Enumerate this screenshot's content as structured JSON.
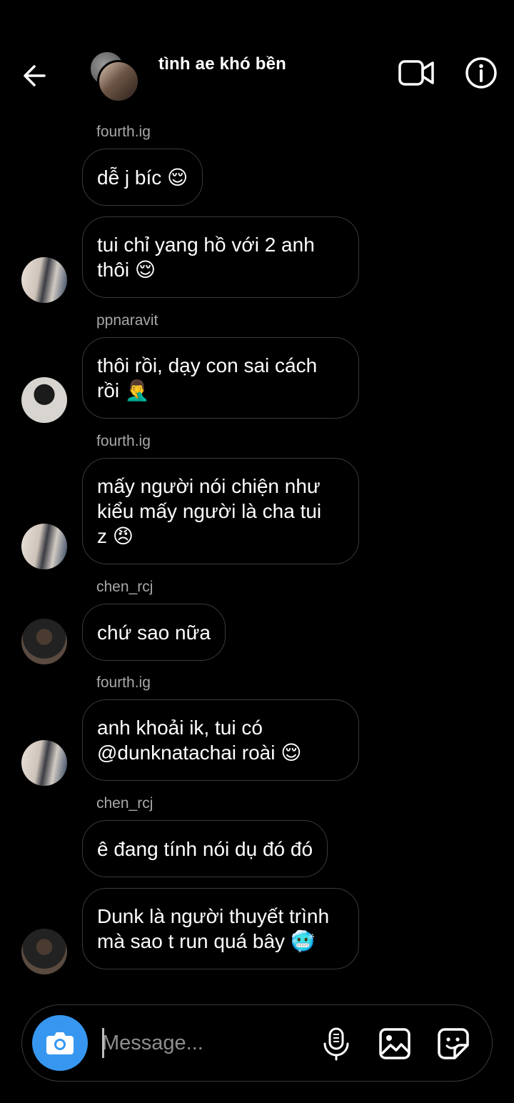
{
  "header": {
    "title": "tình ae khó bền"
  },
  "messages": [
    {
      "sender": "fourth.ig",
      "text": "dễ j bíc 😌"
    },
    {
      "sender": "fourth.ig",
      "text": "tui chỉ yang hồ với 2 anh\nthôi 😌"
    },
    {
      "sender": "ppnaravit",
      "text": "thôi rồi, dạy con sai cách\nrồi 🤦‍♂️"
    },
    {
      "sender": "fourth.ig",
      "text": "mấy người nói chiện như\nkiểu mấy người là cha tui\nz 😠"
    },
    {
      "sender": "chen_rcj",
      "text": "chứ sao nữa"
    },
    {
      "sender": "fourth.ig",
      "text": "anh khoải ik, tui có\n@dunknatachai roài 😌"
    },
    {
      "sender": "chen_rcj",
      "text": "ê đang tính nói dụ đó đó"
    },
    {
      "sender": "chen_rcj",
      "text": "Dunk là người thuyết trình\nmà sao t run quá bây 🥶"
    }
  ],
  "composer": {
    "placeholder": "Message..."
  },
  "icons": {
    "back": "arrow-left-icon",
    "video": "video-camera-icon",
    "info": "info-icon",
    "camera": "camera-icon",
    "mic": "microphone-icon",
    "gallery": "image-icon",
    "sticker": "sticker-icon"
  },
  "colors": {
    "background": "#000000",
    "bubble_border": "#3a3a3a",
    "username": "#a8a8a8",
    "accent": "#3797f0"
  }
}
